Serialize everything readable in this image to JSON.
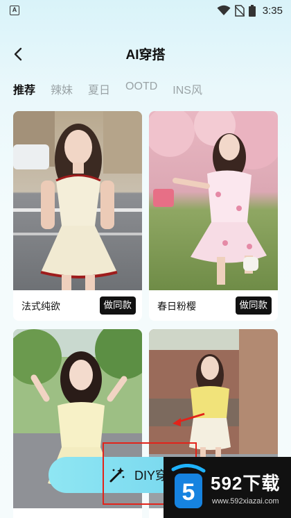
{
  "status_bar": {
    "left_icon_letter": "A",
    "time": "3:35",
    "icons": [
      "wifi-icon",
      "no-sim-icon",
      "battery-icon"
    ]
  },
  "header": {
    "title": "AI穿搭",
    "back_icon": "back-chevron-icon"
  },
  "tabs": [
    {
      "label": "推荐",
      "active": true
    },
    {
      "label": "辣妹",
      "active": false
    },
    {
      "label": "夏日",
      "active": false
    },
    {
      "label": "OOTD",
      "active": false
    },
    {
      "label": "INS风",
      "active": false
    }
  ],
  "cards": [
    {
      "name": "法式纯欲",
      "button": "做同款"
    },
    {
      "name": "春日粉樱",
      "button": "做同款"
    },
    {
      "name": "",
      "button": ""
    },
    {
      "name": "",
      "button": ""
    }
  ],
  "diy_button": {
    "label": "DIY穿",
    "icon": "magic-wand-icon"
  },
  "watermark": {
    "brand": "592下载",
    "url": "www.592xiazai.com"
  },
  "colors": {
    "accent": "#7fdcf0",
    "button_dark": "#111111",
    "annotation_red": "#e2231a"
  }
}
